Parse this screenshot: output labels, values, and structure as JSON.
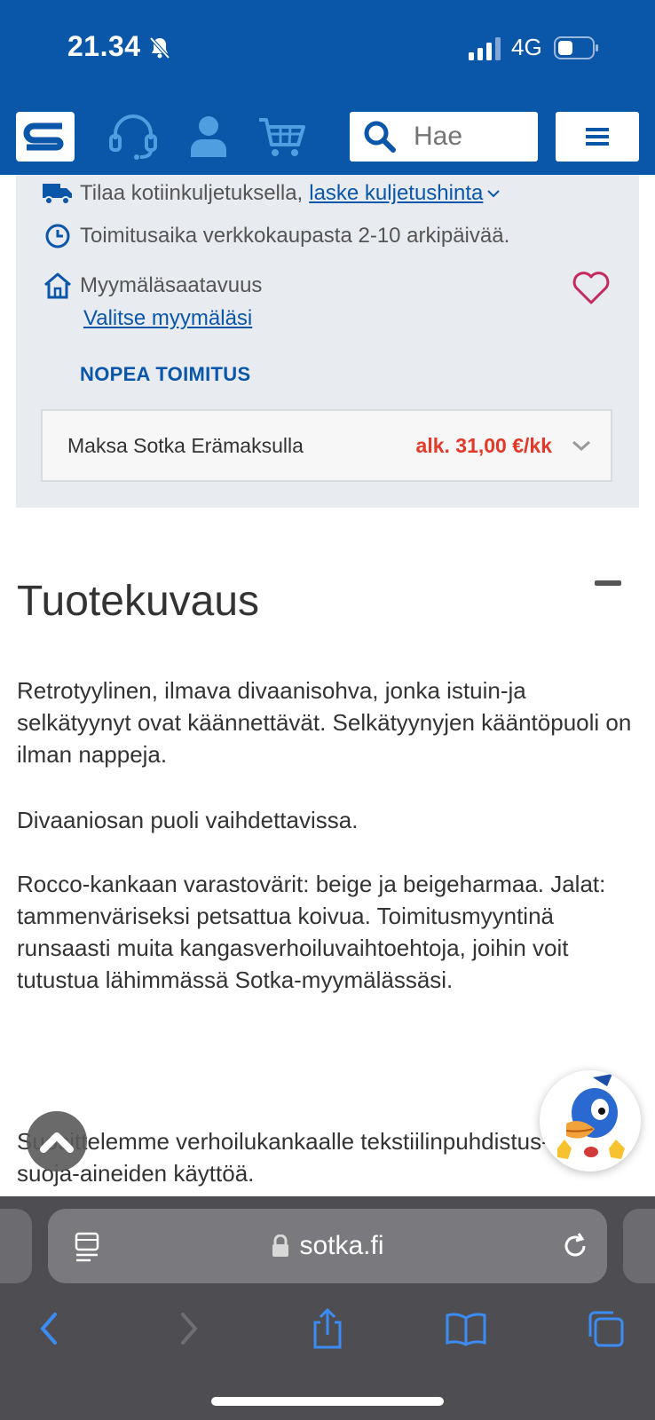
{
  "status": {
    "time": "21.34",
    "network": "4G"
  },
  "header": {
    "search_placeholder": "Hae"
  },
  "delivery": {
    "home_delivery_text": "Tilaa kotiinkuljetuksella,",
    "shipping_link": "laske kuljetushinta",
    "delivery_time": "Toimitusaika verkkokaupasta 2-10 arkipäivää.",
    "store_availability": "Myymäläsaatavuus",
    "select_store": "Valitse myymäläsi",
    "fast_delivery": "NOPEA TOIMITUS"
  },
  "payment": {
    "label": "Maksa Sotka Erämaksulla",
    "price": "alk. 31,00 €/kk"
  },
  "description": {
    "title": "Tuotekuvaus",
    "p1": "Retrotyylinen, ilmava divaanisohva, jonka istuin-ja selkätyynyt ovat käännettävät. Selkätyynyjen kääntöpuoli on ilman nappeja.",
    "p2": "Divaaniosan puoli vaihdettavissa.",
    "p3": "Rocco-kankaan varastovärit: beige ja beigeharmaa. Jalat: tammenväriseksi petsattua koivua. Toimitusmyyntinä runsaasti muita kangasverhoiluvaihtoehtoja, joihin voit tutustua lähimmässä Sotka-myymälässäsi.",
    "p4": "Suosittelemme verhoilukankaalle tekstiilinpuhdistus- ja suoja-aineiden käyttöä."
  },
  "browser": {
    "url": "sotka.fi"
  },
  "colors": {
    "brand_blue": "#0a56a8",
    "price_red": "#e2392b"
  }
}
